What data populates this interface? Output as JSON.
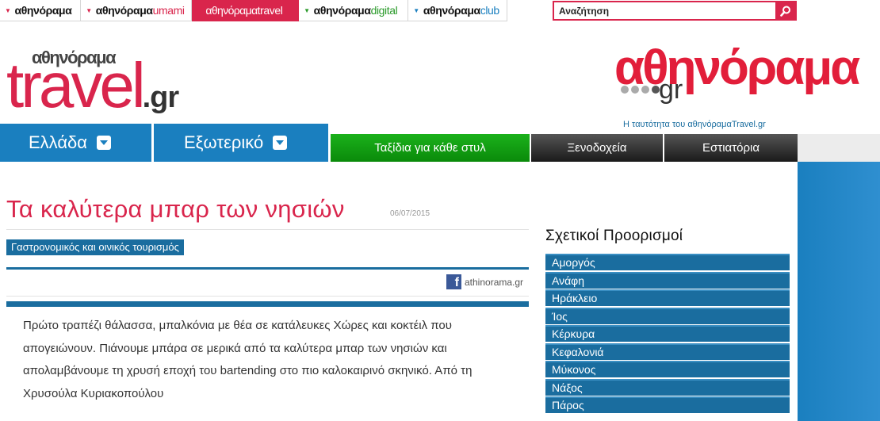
{
  "network": {
    "tabs": [
      {
        "bold": "αθηνόραμα",
        "suffix": "",
        "color": "#d9254c",
        "active": false,
        "arrow": true
      },
      {
        "bold": "αθηνόραμα",
        "suffix": "umami",
        "color": "#d9254c",
        "active": false,
        "arrow": true
      },
      {
        "bold": "αθηνόραμα",
        "suffix": "travel",
        "color": "#ffffff",
        "active": true,
        "arrow": false
      },
      {
        "bold": "αθηνόραμα",
        "suffix": "digital",
        "color": "#2a9a2a",
        "active": false,
        "arrow": true
      },
      {
        "bold": "αθηνόραμα",
        "suffix": "club",
        "color": "#1a7fbf",
        "active": false,
        "arrow": true
      }
    ]
  },
  "search": {
    "placeholder": "Αναζήτηση"
  },
  "logo": {
    "small": "αθηνόραμα",
    "big": "travel",
    "gr": ".gr",
    "athin_word": "αθηνόραμα",
    "athin_gr": "gr"
  },
  "tagline": "Η ταυτότητα του αθηνόραμαTravel.gr",
  "nav": {
    "main": [
      "Ελλάδα",
      "Εξωτερικό"
    ],
    "sub": [
      "Ταξίδια για κάθε στυλ",
      "Ξενοδοχεία",
      "Εστιατόρια"
    ]
  },
  "article": {
    "title": "Τα καλύτερα μπαρ των νησιών",
    "date": "06/07/2015",
    "category": "Γαστρονομικός και οινικός τουρισμός",
    "share_text": "athinorama.gr",
    "lead": "Πρώτο τραπέζι θάλασσα, μπαλκόνια με θέα σε κατάλευκες Χώρες και κοκτέιλ που απογειώνουν. Πιάνουμε μπάρα σε μερικά από τα καλύτερα μπαρ των νησιών και απολαμβάνουμε τη χρυσή εποχή του bartending στο πιο καλοκαιρινό σκηνικό. Από τη Χρυσούλα Κυριακοπούλου"
  },
  "related": {
    "title": "Σχετικοί Προορισμοί",
    "items": [
      "Αμοργός",
      "Ανάφη",
      "Ηράκλειο",
      "Ίος",
      "Κέρκυρα",
      "Κεφαλονιά",
      "Μύκονος",
      "Νάξος",
      "Πάρος"
    ]
  },
  "colors": {
    "brand": "#d9254c",
    "blue": "#1a6d9f",
    "nav_blue": "#1a7fbf",
    "green": "#0a8a0a"
  }
}
